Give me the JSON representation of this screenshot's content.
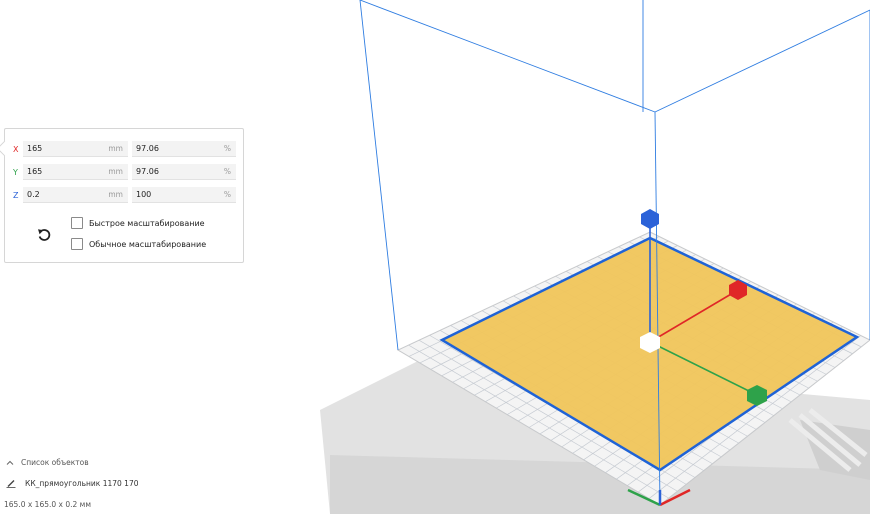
{
  "scale_panel": {
    "rows": [
      {
        "axis": "X",
        "value": "165",
        "unit": "mm",
        "percent": "97.06",
        "percent_unit": "%"
      },
      {
        "axis": "Y",
        "value": "165",
        "unit": "mm",
        "percent": "97.06",
        "percent_unit": "%"
      },
      {
        "axis": "Z",
        "value": "0.2",
        "unit": "mm",
        "percent": "100",
        "percent_unit": "%"
      }
    ],
    "reset_icon": "reset-rotate-icon",
    "snap_scaling_label": "Быстрое масштабирование",
    "snap_scaling_checked": false,
    "uniform_scaling_label": "Обычное масштабирование",
    "uniform_scaling_checked": false
  },
  "object_list": {
    "header": "Список объектов",
    "collapsed_icon": "chevron-up-icon",
    "item_name": "КК_прямоугольник 1170 170",
    "item_icon": "pencil-icon",
    "dimensions": "165.0 x 165.0 x 0.2 мм"
  },
  "viewport": {
    "build_volume_color": "#2f7de1",
    "plate_color": "#f0c65c",
    "axis_colors": {
      "x": "#e02727",
      "y": "#2ea24a",
      "z": "#2b62d8"
    }
  }
}
